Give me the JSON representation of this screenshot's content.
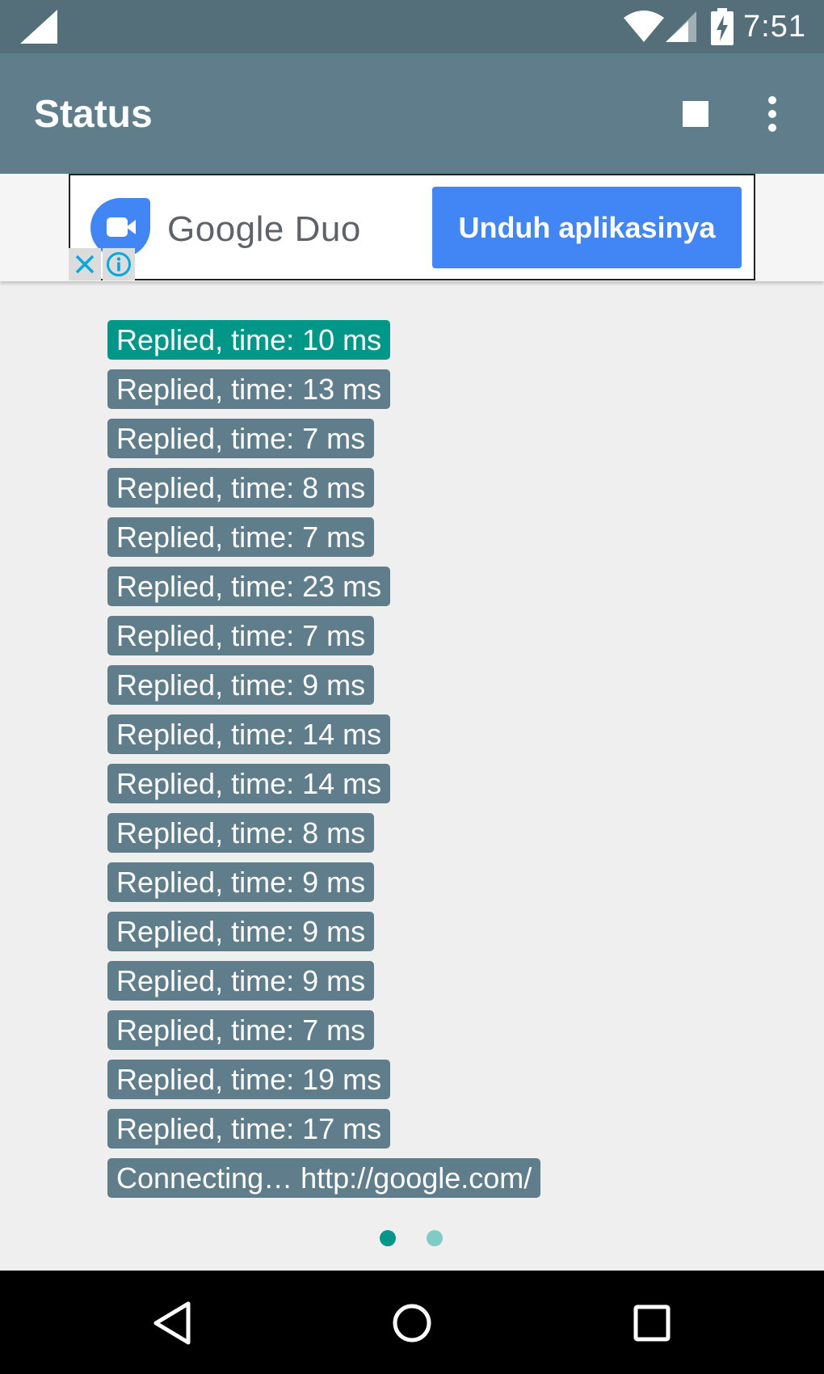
{
  "status_bar": {
    "time": "7:51",
    "icons": [
      "signal-icon",
      "wifi-icon",
      "cell-signal-icon",
      "battery-charging-icon"
    ]
  },
  "app_bar": {
    "title": "Status",
    "actions": [
      "stop-icon",
      "more-vert-icon"
    ]
  },
  "ad": {
    "brand": "Google Duo",
    "cta_label": "Unduh aplikasinya",
    "close_icon": "close-icon",
    "info_icon": "info-icon",
    "brand_color": "#4285f4"
  },
  "log": {
    "entries": [
      "Replied, time: 10 ms",
      "Replied, time: 13 ms",
      "Replied, time: 7 ms",
      "Replied, time: 8 ms",
      "Replied, time: 7 ms",
      "Replied, time: 23 ms",
      "Replied, time: 7 ms",
      "Replied, time: 9 ms",
      "Replied, time: 14 ms",
      "Replied, time: 14 ms",
      "Replied, time: 8 ms",
      "Replied, time: 9 ms",
      "Replied, time: 9 ms",
      "Replied, time: 9 ms",
      "Replied, time: 7 ms",
      "Replied, time: 19 ms",
      "Replied, time: 17 ms",
      "Connecting… http://google.com/"
    ],
    "active_index": 0,
    "entry_color": "#607d8b",
    "active_color": "#009688"
  },
  "pager": {
    "page_count": 2,
    "current_page": 1,
    "active_color": "#009688",
    "inactive_color": "#80cbc4"
  },
  "nav_bar": {
    "buttons": [
      "back-icon",
      "home-icon",
      "recents-icon"
    ]
  }
}
